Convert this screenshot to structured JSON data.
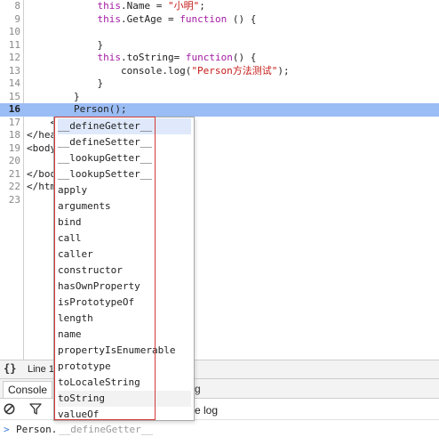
{
  "editor": {
    "lines": [
      {
        "number": "8",
        "tokens": [
          {
            "t": "            "
          },
          {
            "t": "this",
            "k": "kw"
          },
          {
            "t": ".Name = "
          },
          {
            "t": "\"小明\"",
            "k": "str"
          },
          {
            "t": ";"
          }
        ]
      },
      {
        "number": "9",
        "tokens": [
          {
            "t": "            "
          },
          {
            "t": "this",
            "k": "kw"
          },
          {
            "t": ".GetAge = "
          },
          {
            "t": "function",
            "k": "kw"
          },
          {
            "t": " () {"
          }
        ]
      },
      {
        "number": "10",
        "tokens": [
          {
            "t": ""
          }
        ]
      },
      {
        "number": "11",
        "tokens": [
          {
            "t": "            }"
          }
        ]
      },
      {
        "number": "12",
        "tokens": [
          {
            "t": "            "
          },
          {
            "t": "this",
            "k": "kw"
          },
          {
            "t": ".toString= "
          },
          {
            "t": "function",
            "k": "kw"
          },
          {
            "t": "() {"
          }
        ]
      },
      {
        "number": "13",
        "tokens": [
          {
            "t": "                console.log("
          },
          {
            "t": "\"Person方法测试\"",
            "k": "str"
          },
          {
            "t": ");"
          }
        ]
      },
      {
        "number": "14",
        "tokens": [
          {
            "t": "            }"
          }
        ]
      },
      {
        "number": "15",
        "tokens": [
          {
            "t": "        }"
          }
        ]
      },
      {
        "number": "16",
        "tokens": [
          {
            "t": "        Person();"
          }
        ],
        "active": true
      },
      {
        "number": "17",
        "tokens": [
          {
            "t": "    <"
          }
        ]
      },
      {
        "number": "18",
        "tokens": [
          {
            "t": "</hea"
          }
        ]
      },
      {
        "number": "19",
        "tokens": [
          {
            "t": "<body"
          }
        ]
      },
      {
        "number": "20",
        "tokens": [
          {
            "t": ""
          }
        ]
      },
      {
        "number": "21",
        "tokens": [
          {
            "t": "</boo"
          }
        ]
      },
      {
        "number": "22",
        "tokens": [
          {
            "t": "</htm"
          }
        ]
      },
      {
        "number": "23",
        "tokens": [
          {
            "t": ""
          }
        ]
      }
    ]
  },
  "autocomplete": {
    "items": [
      "__defineGetter__",
      "__defineSetter__",
      "__lookupGetter__",
      "__lookupSetter__",
      "apply",
      "arguments",
      "bind",
      "call",
      "caller",
      "constructor",
      "hasOwnProperty",
      "isPrototypeOf",
      "length",
      "name",
      "propertyIsEnumerable",
      "prototype",
      "toLocaleString",
      "toString",
      "valueOf"
    ],
    "selected_index": 0,
    "hover_index": 17
  },
  "status_bar": {
    "braces_icon": "{}",
    "position_text": "Line 1"
  },
  "drawer": {
    "console_tab": "Console",
    "obscured_tab_tail": "g"
  },
  "console_toolbar": {
    "clear_icon": "clear-console-icon",
    "filter_icon": "filter-icon",
    "obscured_option_tail": "e log"
  },
  "console_prompt": {
    "arrow": ">",
    "typed": "Person.",
    "hint": "__defineGetter__"
  },
  "colors": {
    "active_line": "#9bbdf5",
    "keyword": "#a31ca3",
    "string": "#c41a16",
    "highlight_frame": "#d23a3a"
  }
}
